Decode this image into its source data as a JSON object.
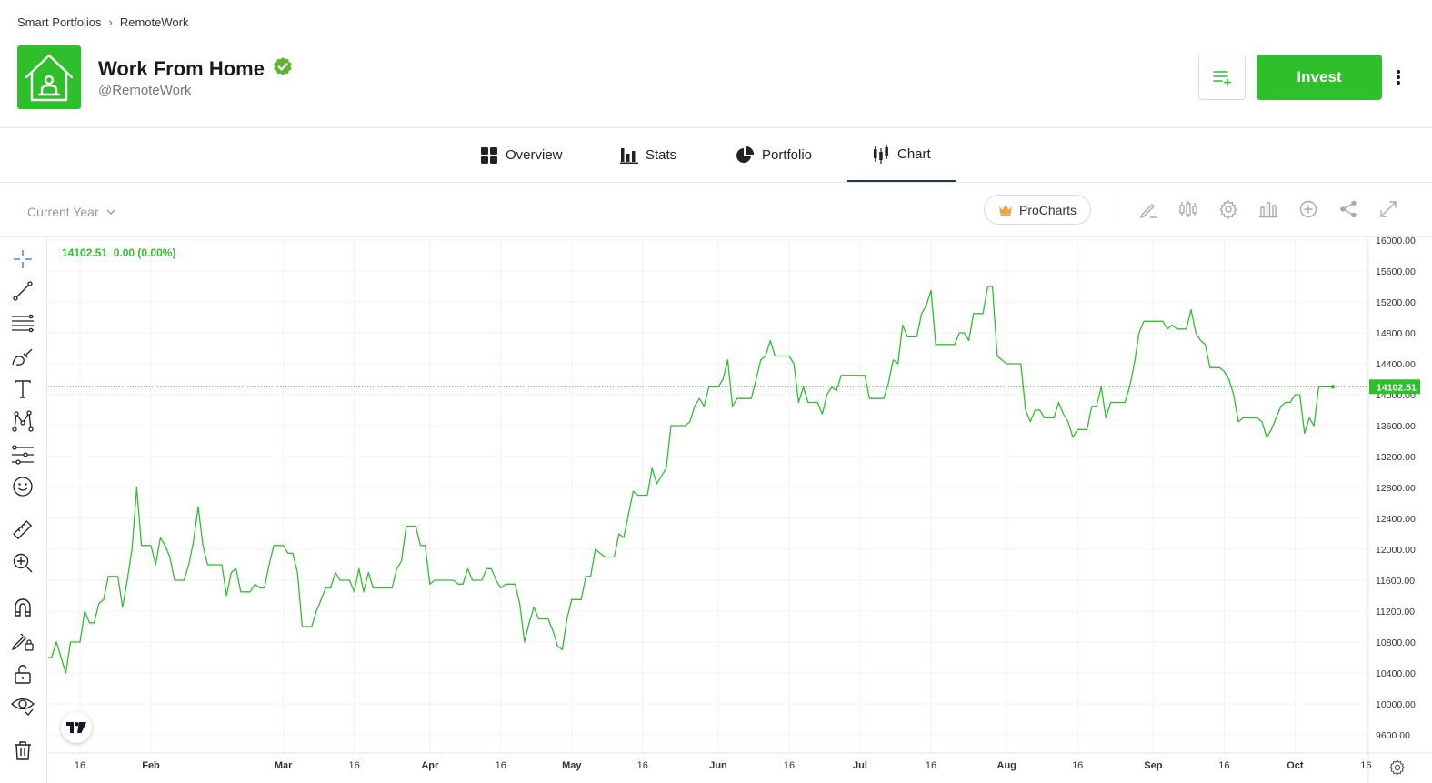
{
  "breadcrumb": {
    "root": "Smart Portfolios",
    "current": "RemoteWork"
  },
  "header": {
    "title": "Work From Home",
    "handle": "@RemoteWork",
    "invest_label": "Invest"
  },
  "tabs": [
    {
      "label": "Overview",
      "icon": "grid-icon"
    },
    {
      "label": "Stats",
      "icon": "bar-chart-icon"
    },
    {
      "label": "Portfolio",
      "icon": "pie-chart-icon"
    },
    {
      "label": "Chart",
      "icon": "candlestick-icon",
      "active": true
    }
  ],
  "toolbar": {
    "range": "Current Year",
    "procharts": "ProCharts"
  },
  "colors": {
    "accent": "#2fbf2c",
    "tab_underline": "#1d3a52",
    "line": "#2fbf2c"
  },
  "chart_legend": {
    "value": "14102.51",
    "change": "0.00 (0.00%)"
  },
  "chart_data": {
    "type": "line",
    "title": "",
    "xlabel": "",
    "ylabel": "",
    "ylim": [
      9400,
      16000
    ],
    "y_ticks": [
      "9600.00",
      "10000.00",
      "10400.00",
      "10800.00",
      "11200.00",
      "11600.00",
      "12000.00",
      "12400.00",
      "12800.00",
      "13200.00",
      "13600.00",
      "14000.00",
      "14400.00",
      "14800.00",
      "15200.00",
      "15600.00",
      "16000.00"
    ],
    "x_ticks": [
      {
        "label": "16",
        "day": -15
      },
      {
        "label": "Feb",
        "day": 0
      },
      {
        "label": "Mar",
        "day": 28
      },
      {
        "label": "16",
        "day": 43
      },
      {
        "label": "Apr",
        "day": 59
      },
      {
        "label": "16",
        "day": 74
      },
      {
        "label": "May",
        "day": 89
      },
      {
        "label": "16",
        "day": 104
      },
      {
        "label": "Jun",
        "day": 120
      },
      {
        "label": "16",
        "day": 135
      },
      {
        "label": "Jul",
        "day": 150
      },
      {
        "label": "16",
        "day": 165
      },
      {
        "label": "Aug",
        "day": 181
      },
      {
        "label": "16",
        "day": 196
      },
      {
        "label": "Sep",
        "day": 212
      },
      {
        "label": "16",
        "day": 227
      },
      {
        "label": "Oct",
        "day": 242
      },
      {
        "label": "16",
        "day": 257
      }
    ],
    "last_value": 14102.51,
    "last_value_label": "14102.51",
    "series": [
      {
        "values": [
          [
            -26,
            10100
          ],
          [
            -25,
            10400
          ],
          [
            -24,
            10600
          ],
          [
            -23,
            10600
          ],
          [
            -22,
            10600
          ],
          [
            -21,
            10600
          ],
          [
            -20,
            10800
          ],
          [
            -19,
            10600
          ],
          [
            -18,
            10400
          ],
          [
            -17,
            10800
          ],
          [
            -16,
            10800
          ],
          [
            -15,
            10800
          ],
          [
            -14,
            11200
          ],
          [
            -13,
            11050
          ],
          [
            -12,
            11050
          ],
          [
            -11,
            11300
          ],
          [
            -10,
            11350
          ],
          [
            -9,
            11650
          ],
          [
            -8,
            11650
          ],
          [
            -7,
            11650
          ],
          [
            -6,
            11250
          ],
          [
            -5,
            11600
          ],
          [
            -4,
            12000
          ],
          [
            -3,
            12800
          ],
          [
            -2,
            12050
          ],
          [
            -1,
            12050
          ],
          [
            0,
            12050
          ],
          [
            1,
            11800
          ],
          [
            2,
            12150
          ],
          [
            3,
            12050
          ],
          [
            4,
            11900
          ],
          [
            5,
            11600
          ],
          [
            6,
            11600
          ],
          [
            7,
            11600
          ],
          [
            8,
            11800
          ],
          [
            9,
            12100
          ],
          [
            10,
            12550
          ],
          [
            11,
            12050
          ],
          [
            12,
            11800
          ],
          [
            13,
            11800
          ],
          [
            14,
            11800
          ],
          [
            15,
            11800
          ],
          [
            16,
            11400
          ],
          [
            17,
            11700
          ],
          [
            18,
            11750
          ],
          [
            19,
            11450
          ],
          [
            20,
            11450
          ],
          [
            21,
            11450
          ],
          [
            22,
            11550
          ],
          [
            23,
            11500
          ],
          [
            24,
            11500
          ],
          [
            25,
            11800
          ],
          [
            26,
            12050
          ],
          [
            27,
            12050
          ],
          [
            28,
            12050
          ],
          [
            29,
            11950
          ],
          [
            30,
            11950
          ],
          [
            31,
            11700
          ],
          [
            32,
            11000
          ],
          [
            33,
            11000
          ],
          [
            34,
            11000
          ],
          [
            35,
            11200
          ],
          [
            36,
            11350
          ],
          [
            37,
            11500
          ],
          [
            38,
            11500
          ],
          [
            39,
            11700
          ],
          [
            40,
            11600
          ],
          [
            41,
            11600
          ],
          [
            42,
            11600
          ],
          [
            43,
            11450
          ],
          [
            44,
            11750
          ],
          [
            45,
            11450
          ],
          [
            46,
            11700
          ],
          [
            47,
            11500
          ],
          [
            48,
            11500
          ],
          [
            49,
            11500
          ],
          [
            50,
            11500
          ],
          [
            51,
            11500
          ],
          [
            52,
            11750
          ],
          [
            53,
            11850
          ],
          [
            54,
            12300
          ],
          [
            55,
            12300
          ],
          [
            56,
            12300
          ],
          [
            57,
            12050
          ],
          [
            58,
            12050
          ],
          [
            59,
            11550
          ],
          [
            60,
            11600
          ],
          [
            61,
            11600
          ],
          [
            62,
            11600
          ],
          [
            63,
            11600
          ],
          [
            64,
            11600
          ],
          [
            65,
            11550
          ],
          [
            66,
            11550
          ],
          [
            67,
            11750
          ],
          [
            68,
            11600
          ],
          [
            69,
            11600
          ],
          [
            70,
            11600
          ],
          [
            71,
            11750
          ],
          [
            72,
            11750
          ],
          [
            73,
            11600
          ],
          [
            74,
            11500
          ],
          [
            75,
            11550
          ],
          [
            76,
            11550
          ],
          [
            77,
            11550
          ],
          [
            78,
            11300
          ],
          [
            79,
            10800
          ],
          [
            80,
            11050
          ],
          [
            81,
            11250
          ],
          [
            82,
            11100
          ],
          [
            83,
            11100
          ],
          [
            84,
            11100
          ],
          [
            85,
            10950
          ],
          [
            86,
            10750
          ],
          [
            87,
            10700
          ],
          [
            88,
            11100
          ],
          [
            89,
            11350
          ],
          [
            90,
            11350
          ],
          [
            91,
            11350
          ],
          [
            92,
            11650
          ],
          [
            93,
            11650
          ],
          [
            94,
            12000
          ],
          [
            95,
            11950
          ],
          [
            96,
            11900
          ],
          [
            97,
            11900
          ],
          [
            98,
            11900
          ],
          [
            99,
            12200
          ],
          [
            100,
            12150
          ],
          [
            101,
            12450
          ],
          [
            102,
            12750
          ],
          [
            103,
            12700
          ],
          [
            104,
            12700
          ],
          [
            105,
            12700
          ],
          [
            106,
            13050
          ],
          [
            107,
            12850
          ],
          [
            108,
            12950
          ],
          [
            109,
            13050
          ],
          [
            110,
            13600
          ],
          [
            111,
            13600
          ],
          [
            112,
            13600
          ],
          [
            113,
            13600
          ],
          [
            114,
            13650
          ],
          [
            115,
            13850
          ],
          [
            116,
            13950
          ],
          [
            117,
            13850
          ],
          [
            118,
            14100
          ],
          [
            119,
            14100
          ],
          [
            120,
            14100
          ],
          [
            121,
            14200
          ],
          [
            122,
            14450
          ],
          [
            123,
            13850
          ],
          [
            124,
            13950
          ],
          [
            125,
            13950
          ],
          [
            126,
            13950
          ],
          [
            127,
            13950
          ],
          [
            128,
            14200
          ],
          [
            129,
            14450
          ],
          [
            130,
            14500
          ],
          [
            131,
            14700
          ],
          [
            132,
            14500
          ],
          [
            133,
            14500
          ],
          [
            134,
            14500
          ],
          [
            135,
            14500
          ],
          [
            136,
            14400
          ],
          [
            137,
            13900
          ],
          [
            138,
            14100
          ],
          [
            139,
            13900
          ],
          [
            140,
            13900
          ],
          [
            141,
            13900
          ],
          [
            142,
            13750
          ],
          [
            143,
            14000
          ],
          [
            144,
            14100
          ],
          [
            145,
            14050
          ],
          [
            146,
            14250
          ],
          [
            147,
            14250
          ],
          [
            148,
            14250
          ],
          [
            149,
            14250
          ],
          [
            150,
            14250
          ],
          [
            151,
            14250
          ],
          [
            152,
            13950
          ],
          [
            153,
            13950
          ],
          [
            154,
            13950
          ],
          [
            155,
            13950
          ],
          [
            156,
            14150
          ],
          [
            157,
            14450
          ],
          [
            158,
            14400
          ],
          [
            159,
            14900
          ],
          [
            160,
            14750
          ],
          [
            161,
            14750
          ],
          [
            162,
            14750
          ],
          [
            163,
            15050
          ],
          [
            164,
            15150
          ],
          [
            165,
            15350
          ],
          [
            166,
            14650
          ],
          [
            167,
            14650
          ],
          [
            168,
            14650
          ],
          [
            169,
            14650
          ],
          [
            170,
            14650
          ],
          [
            171,
            14800
          ],
          [
            172,
            14800
          ],
          [
            173,
            14700
          ],
          [
            174,
            15050
          ],
          [
            175,
            15050
          ],
          [
            176,
            15050
          ],
          [
            177,
            15400
          ],
          [
            178,
            15400
          ],
          [
            179,
            14500
          ],
          [
            180,
            14450
          ],
          [
            181,
            14400
          ],
          [
            182,
            14400
          ],
          [
            183,
            14400
          ],
          [
            184,
            14400
          ],
          [
            185,
            13800
          ],
          [
            186,
            13650
          ],
          [
            187,
            13800
          ],
          [
            188,
            13800
          ],
          [
            189,
            13700
          ],
          [
            190,
            13700
          ],
          [
            191,
            13700
          ],
          [
            192,
            13900
          ],
          [
            193,
            13750
          ],
          [
            194,
            13650
          ],
          [
            195,
            13450
          ],
          [
            196,
            13550
          ],
          [
            197,
            13550
          ],
          [
            198,
            13550
          ],
          [
            199,
            13850
          ],
          [
            200,
            13850
          ],
          [
            201,
            14100
          ],
          [
            202,
            13700
          ],
          [
            203,
            13900
          ],
          [
            204,
            13900
          ],
          [
            205,
            13900
          ],
          [
            206,
            13900
          ],
          [
            207,
            14100
          ],
          [
            208,
            14400
          ],
          [
            209,
            14800
          ],
          [
            210,
            14950
          ],
          [
            211,
            14950
          ],
          [
            212,
            14950
          ],
          [
            213,
            14950
          ],
          [
            214,
            14950
          ],
          [
            215,
            14850
          ],
          [
            216,
            14900
          ],
          [
            217,
            14850
          ],
          [
            218,
            14850
          ],
          [
            219,
            14850
          ],
          [
            220,
            15100
          ],
          [
            221,
            14800
          ],
          [
            222,
            14700
          ],
          [
            223,
            14650
          ],
          [
            224,
            14350
          ],
          [
            225,
            14350
          ],
          [
            226,
            14350
          ],
          [
            227,
            14300
          ],
          [
            228,
            14200
          ],
          [
            229,
            14000
          ],
          [
            230,
            13650
          ],
          [
            231,
            13700
          ],
          [
            232,
            13700
          ],
          [
            233,
            13700
          ],
          [
            234,
            13700
          ],
          [
            235,
            13650
          ],
          [
            236,
            13450
          ],
          [
            237,
            13550
          ],
          [
            238,
            13700
          ],
          [
            239,
            13850
          ],
          [
            240,
            13900
          ],
          [
            241,
            13900
          ],
          [
            242,
            14000
          ],
          [
            243,
            14000
          ],
          [
            244,
            13500
          ],
          [
            245,
            13700
          ],
          [
            246,
            13600
          ],
          [
            247,
            14100
          ],
          [
            248,
            14100
          ],
          [
            249,
            14100
          ],
          [
            250,
            14102.51
          ]
        ]
      }
    ]
  }
}
